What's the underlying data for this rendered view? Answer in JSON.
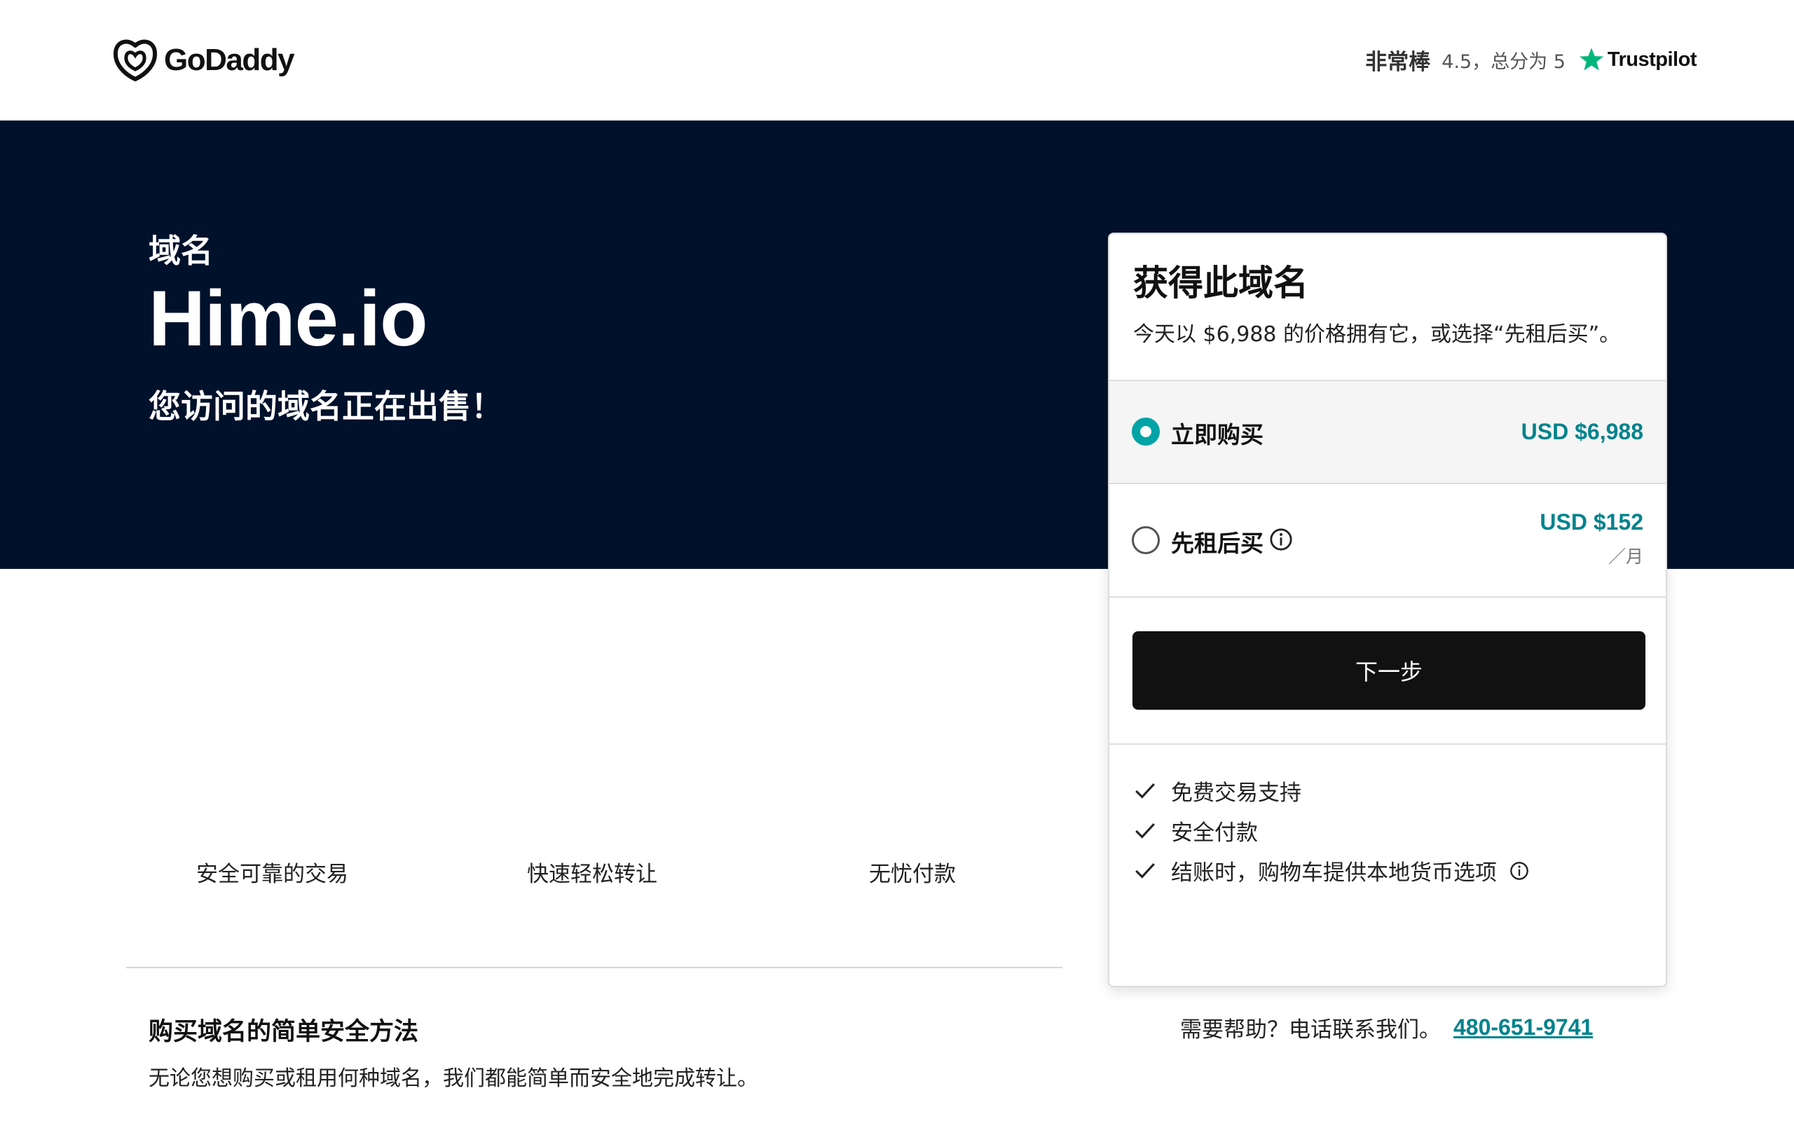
{
  "header": {
    "logo_text": "GoDaddy",
    "rating_word": "非常棒",
    "rating_score": "4.5，总分为 5",
    "trustpilot": "Trustpilot"
  },
  "hero": {
    "label": "域名",
    "domain": "Hime.io",
    "subtitle": "您访问的域名正在出售！"
  },
  "features": [
    "安全可靠的交易",
    "快速轻松转让",
    "无忧付款"
  ],
  "info": {
    "title": "购买域名的简单安全方法",
    "desc": "无论您想购买或租用何种域名，我们都能简单而安全地完成转让。"
  },
  "card": {
    "title": "获得此域名",
    "desc": "今天以 $6,988 的价格拥有它，或选择“先租后买”。",
    "options": [
      {
        "label": "立即购买",
        "price": "USD $6,988",
        "selected": true
      },
      {
        "label": "先租后买",
        "price": "USD $152",
        "period": "／月",
        "selected": false
      }
    ],
    "next_label": "下一步",
    "benefits": [
      "免费交易支持",
      "安全付款",
      "结账时，购物车提供本地货币选项"
    ]
  },
  "help": {
    "text": "需要帮助？电话联系我们。",
    "phone": "480-651-9741"
  },
  "colors": {
    "hero_bg": "#00112b",
    "accent": "#00a4a6",
    "price": "#00838c",
    "button": "#111111",
    "trustpilot_green": "#00b67a"
  }
}
